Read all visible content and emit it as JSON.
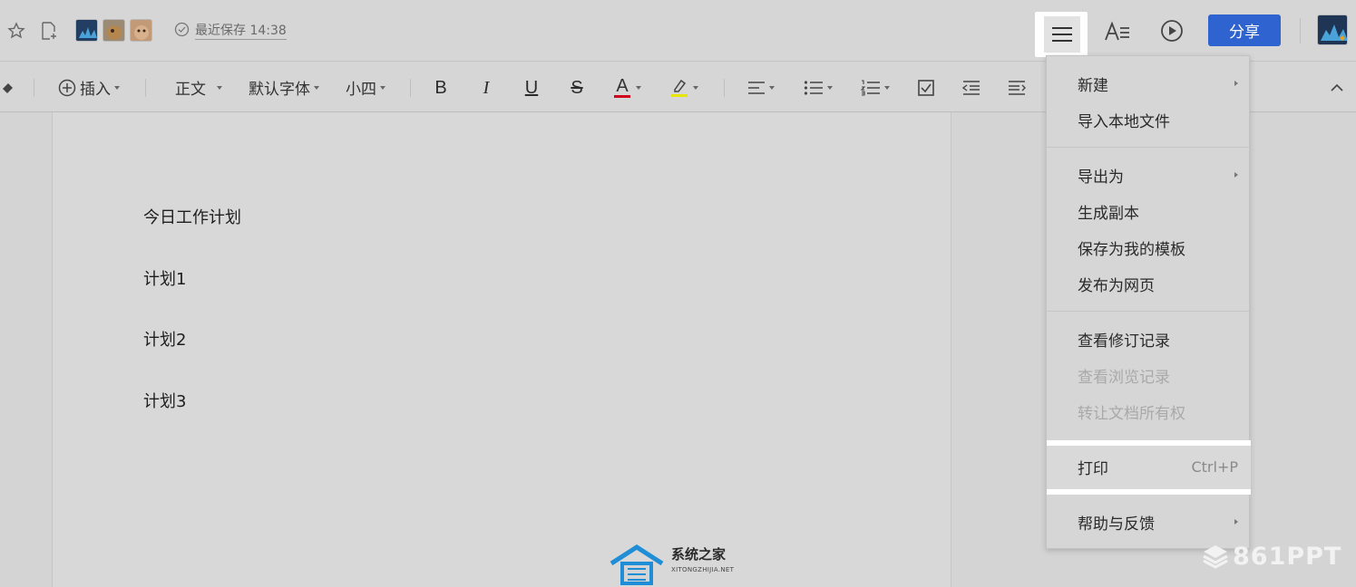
{
  "header": {
    "save_status": "最近保存 14:38",
    "share_label": "分享",
    "icons": [
      "star-icon",
      "add-file-icon",
      "check-circle-icon",
      "menu-icon",
      "text-format-icon",
      "play-icon"
    ]
  },
  "toolbar": {
    "insert_label": "插入",
    "style_label": "正文",
    "font_label": "默认字体",
    "size_label": "小四",
    "bold": "B",
    "italic": "I",
    "underline": "U",
    "strike": "S",
    "font_color_letter": "A"
  },
  "document": {
    "lines": [
      "今日工作计划",
      "计划1",
      "计划2",
      "计划3"
    ]
  },
  "menu": {
    "items": [
      {
        "label": "新建",
        "submenu": true
      },
      {
        "label": "导入本地文件"
      },
      {
        "label": "导出为",
        "submenu": true
      },
      {
        "label": "生成副本"
      },
      {
        "label": "保存为我的模板"
      },
      {
        "label": "发布为网页"
      },
      {
        "label": "查看修订记录"
      },
      {
        "label": "查看浏览记录",
        "disabled": true
      },
      {
        "label": "转让文档所有权",
        "disabled": true
      },
      {
        "label": "打印",
        "shortcut": "Ctrl+P"
      },
      {
        "label": "帮助与反馈",
        "submenu": true
      }
    ]
  },
  "watermarks": {
    "site_name": "系统之家",
    "site_url": "XITONGZHIJIA.NET",
    "brand": "861PPT"
  },
  "colors": {
    "accent": "#2f63cf",
    "font_color_underline": "#d0021b",
    "highlight_underline": "#e6e600"
  }
}
